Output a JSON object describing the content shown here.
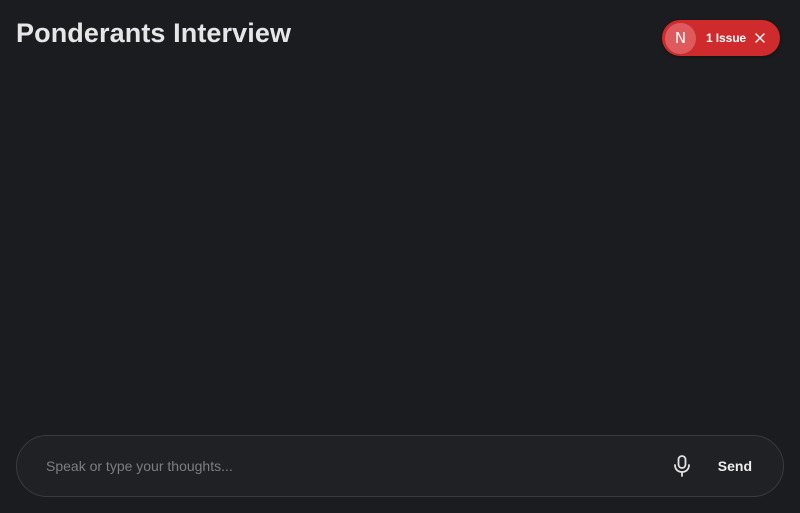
{
  "header": {
    "title": "Ponderants Interview"
  },
  "issues_indicator": {
    "badge_letter": "N",
    "label": "1 Issue",
    "badge_icon": "nextjs-icon",
    "close_icon": "close-icon",
    "color": "#cf2b2d"
  },
  "composer": {
    "placeholder": "Speak or type your thoughts...",
    "value": "",
    "mic_icon": "microphone-icon",
    "send_label": "Send"
  },
  "colors": {
    "background": "#1b1c1f",
    "composer_bg": "#202124",
    "composer_border": "#3a3b3f",
    "issue_red": "#cf2b2d"
  }
}
